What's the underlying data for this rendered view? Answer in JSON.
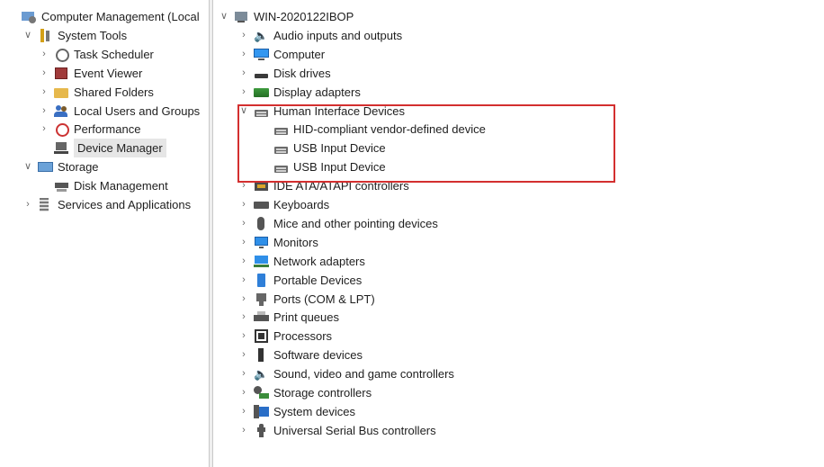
{
  "left_tree": [
    {
      "label": "Computer Management (Local",
      "indent": 0,
      "arrow": "",
      "icon": "mgmt-icon"
    },
    {
      "label": "System Tools",
      "indent": 1,
      "arrow": "v",
      "icon": "system-tools-icon"
    },
    {
      "label": "Task Scheduler",
      "indent": 2,
      "arrow": ">",
      "icon": "clock-icon"
    },
    {
      "label": "Event Viewer",
      "indent": 2,
      "arrow": ">",
      "icon": "event-viewer-icon"
    },
    {
      "label": "Shared Folders",
      "indent": 2,
      "arrow": ">",
      "icon": "shared-folders-icon"
    },
    {
      "label": "Local Users and Groups",
      "indent": 2,
      "arrow": ">",
      "icon": "users-icon"
    },
    {
      "label": "Performance",
      "indent": 2,
      "arrow": ">",
      "icon": "performance-icon"
    },
    {
      "label": "Device Manager",
      "indent": 2,
      "arrow": "",
      "icon": "device-manager-icon",
      "selected": true
    },
    {
      "label": "Storage",
      "indent": 1,
      "arrow": "v",
      "icon": "storage-icon"
    },
    {
      "label": "Disk Management",
      "indent": 2,
      "arrow": "",
      "icon": "disk-management-icon"
    },
    {
      "label": "Services and Applications",
      "indent": 1,
      "arrow": ">",
      "icon": "services-icon"
    }
  ],
  "right_tree": [
    {
      "label": "WIN-2020122IBOP",
      "indent": 0,
      "arrow": "v",
      "icon": "host-icon"
    },
    {
      "label": "Audio inputs and outputs",
      "indent": 1,
      "arrow": ">",
      "icon": "speaker-icon"
    },
    {
      "label": "Computer",
      "indent": 1,
      "arrow": ">",
      "icon": "computer-icon"
    },
    {
      "label": "Disk drives",
      "indent": 1,
      "arrow": ">",
      "icon": "disk-drive-icon"
    },
    {
      "label": "Display adapters",
      "indent": 1,
      "arrow": ">",
      "icon": "display-adapter-icon"
    },
    {
      "label": "Human Interface Devices",
      "indent": 1,
      "arrow": "v",
      "icon": "hid-icon"
    },
    {
      "label": "HID-compliant vendor-defined device",
      "indent": 2,
      "arrow": "",
      "icon": "hid-icon"
    },
    {
      "label": "USB Input Device",
      "indent": 2,
      "arrow": "",
      "icon": "hid-icon"
    },
    {
      "label": "USB Input Device",
      "indent": 2,
      "arrow": "",
      "icon": "hid-icon"
    },
    {
      "label": "IDE ATA/ATAPI controllers",
      "indent": 1,
      "arrow": ">",
      "icon": "ide-icon"
    },
    {
      "label": "Keyboards",
      "indent": 1,
      "arrow": ">",
      "icon": "keyboard-icon"
    },
    {
      "label": "Mice and other pointing devices",
      "indent": 1,
      "arrow": ">",
      "icon": "mouse-icon"
    },
    {
      "label": "Monitors",
      "indent": 1,
      "arrow": ">",
      "icon": "monitor-icon"
    },
    {
      "label": "Network adapters",
      "indent": 1,
      "arrow": ">",
      "icon": "network-icon"
    },
    {
      "label": "Portable Devices",
      "indent": 1,
      "arrow": ">",
      "icon": "portable-icon"
    },
    {
      "label": "Ports (COM & LPT)",
      "indent": 1,
      "arrow": ">",
      "icon": "ports-icon"
    },
    {
      "label": "Print queues",
      "indent": 1,
      "arrow": ">",
      "icon": "printer-icon"
    },
    {
      "label": "Processors",
      "indent": 1,
      "arrow": ">",
      "icon": "cpu-icon"
    },
    {
      "label": "Software devices",
      "indent": 1,
      "arrow": ">",
      "icon": "software-icon"
    },
    {
      "label": "Sound, video and game controllers",
      "indent": 1,
      "arrow": ">",
      "icon": "speaker-icon"
    },
    {
      "label": "Storage controllers",
      "indent": 1,
      "arrow": ">",
      "icon": "storage-controller-icon"
    },
    {
      "label": "System devices",
      "indent": 1,
      "arrow": ">",
      "icon": "system-devices-icon"
    },
    {
      "label": "Universal Serial Bus controllers",
      "indent": 1,
      "arrow": ">",
      "icon": "usb-icon"
    }
  ],
  "highlight_color": "#d32f2f",
  "selection_color": "#e6e6e6"
}
